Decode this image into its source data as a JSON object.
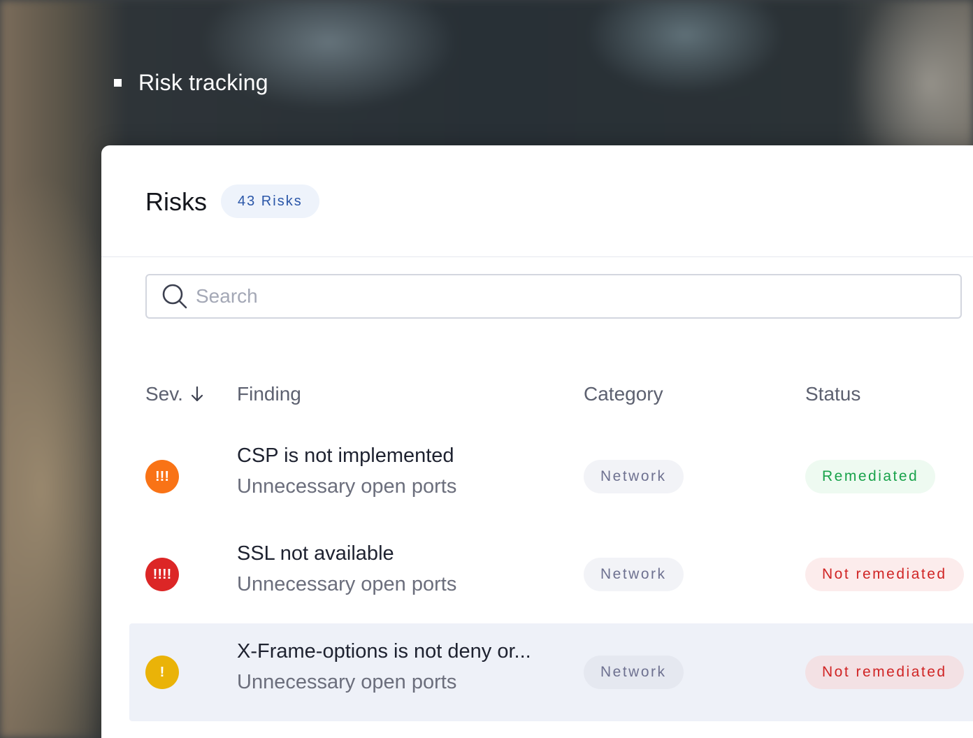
{
  "section": {
    "heading": "Risk tracking"
  },
  "card": {
    "title": "Risks",
    "count_badge": "43 Risks"
  },
  "search": {
    "placeholder": "Search",
    "value": ""
  },
  "table": {
    "columns": {
      "severity": "Sev.",
      "finding": "Finding",
      "category": "Category",
      "status": "Status"
    },
    "sort": {
      "column": "severity",
      "direction": "descending"
    },
    "rows": [
      {
        "severity_marks": "!!!",
        "severity_color": "#f97316",
        "title": "CSP is not implemented",
        "subtitle": "Unnecessary open ports",
        "category": "Network",
        "status": "Remediated",
        "status_kind": "ok"
      },
      {
        "severity_marks": "!!!!",
        "severity_color": "#dc2626",
        "title": "SSL not available",
        "subtitle": "Unnecessary open ports",
        "category": "Network",
        "status": "Not remediated",
        "status_kind": "bad"
      },
      {
        "severity_marks": "!",
        "severity_color": "#eab308",
        "title": "X-Frame-options is not deny or...",
        "subtitle": "Unnecessary open ports",
        "category": "Network",
        "status": "Not remediated",
        "status_kind": "bad",
        "selected": true
      }
    ]
  },
  "icons": {
    "search": "search-icon",
    "sort": "arrow-down-icon",
    "bullet": "square-bullet-icon"
  }
}
